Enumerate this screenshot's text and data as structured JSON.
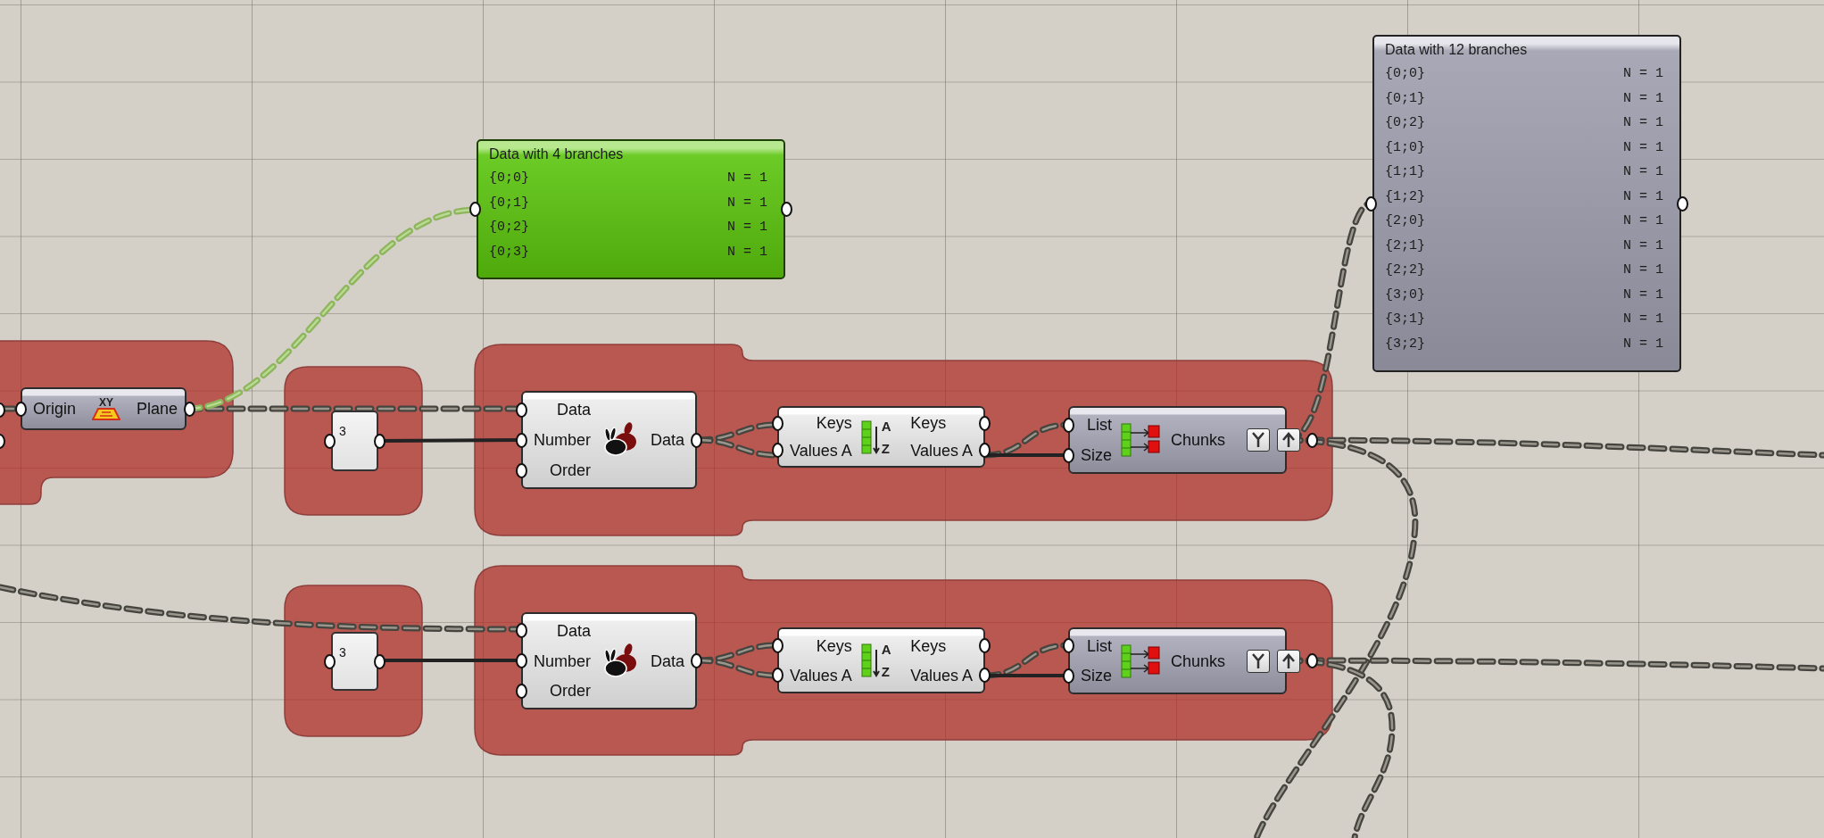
{
  "panels": [
    {
      "kind": "green",
      "title": "Data with 4 branches",
      "rows": [
        {
          "path": "{0;0}",
          "count": "N = 1"
        },
        {
          "path": "{0;1}",
          "count": "N = 1"
        },
        {
          "path": "{0;2}",
          "count": "N = 1"
        },
        {
          "path": "{0;3}",
          "count": "N = 1"
        }
      ]
    },
    {
      "kind": "grey",
      "title": "Data with 12 branches",
      "rows": [
        {
          "path": "{0;0}",
          "count": "N = 1"
        },
        {
          "path": "{0;1}",
          "count": "N = 1"
        },
        {
          "path": "{0;2}",
          "count": "N = 1"
        },
        {
          "path": "{1;0}",
          "count": "N = 1"
        },
        {
          "path": "{1;1}",
          "count": "N = 1"
        },
        {
          "path": "{1;2}",
          "count": "N = 1"
        },
        {
          "path": "{2;0}",
          "count": "N = 1"
        },
        {
          "path": "{2;1}",
          "count": "N = 1"
        },
        {
          "path": "{2;2}",
          "count": "N = 1"
        },
        {
          "path": "{3;0}",
          "count": "N = 1"
        },
        {
          "path": "{3;1}",
          "count": "N = 1"
        },
        {
          "path": "{3;2}",
          "count": "N = 1"
        }
      ]
    }
  ],
  "components": [
    {
      "kind": "plane",
      "inputs": [
        "Origin"
      ],
      "outputs": [
        "Plane"
      ],
      "icon_label": "XY"
    },
    {
      "kind": "number",
      "value": "3"
    },
    {
      "kind": "duplicate",
      "inputs": [
        "Data",
        "Number",
        "Order"
      ],
      "outputs": [
        "Data"
      ]
    },
    {
      "kind": "sort",
      "inputs": [
        "Keys",
        "Values A"
      ],
      "outputs": [
        "Keys",
        "Values A"
      ],
      "icon_letters": [
        "A",
        "Z"
      ]
    },
    {
      "kind": "split",
      "inputs": [
        "List",
        "Size"
      ],
      "outputs": [
        "Chunks"
      ]
    },
    {
      "kind": "number",
      "value": "3"
    },
    {
      "kind": "duplicate",
      "inputs": [
        "Data",
        "Number",
        "Order"
      ],
      "outputs": [
        "Data"
      ]
    },
    {
      "kind": "sort",
      "inputs": [
        "Keys",
        "Values A"
      ],
      "outputs": [
        "Keys",
        "Values A"
      ],
      "icon_letters": [
        "A",
        "Z"
      ]
    },
    {
      "kind": "split",
      "inputs": [
        "List",
        "Size"
      ],
      "outputs": [
        "Chunks"
      ]
    }
  ]
}
